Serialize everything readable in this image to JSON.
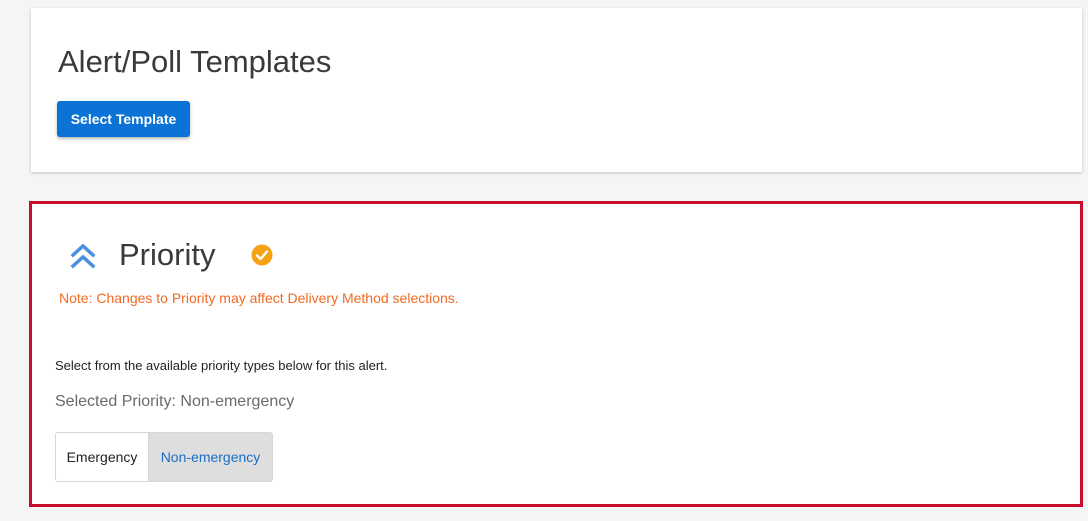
{
  "templates_card": {
    "title": "Alert/Poll Templates",
    "select_template_label": "Select Template"
  },
  "priority_section": {
    "title": "Priority",
    "collapse_icon": "double-chevron-up-icon",
    "status_icon": "check-circle-icon",
    "note": "Note: Changes to Priority may affect Delivery Method selections.",
    "instruction": "Select from the available priority types below for this alert.",
    "selected_label": "Selected Priority: Non-emergency",
    "options": [
      {
        "label": "Emergency",
        "selected": false
      },
      {
        "label": "Non-emergency",
        "selected": true
      }
    ]
  },
  "colors": {
    "primary_button": "#0b72d6",
    "highlight_border": "#c8102e",
    "note_text": "#f06a22",
    "check_badge": "#f5a312",
    "chevron": "#4a8fe0",
    "selected_option_text": "#1a6ec4",
    "selected_option_bg": "#dedede"
  }
}
